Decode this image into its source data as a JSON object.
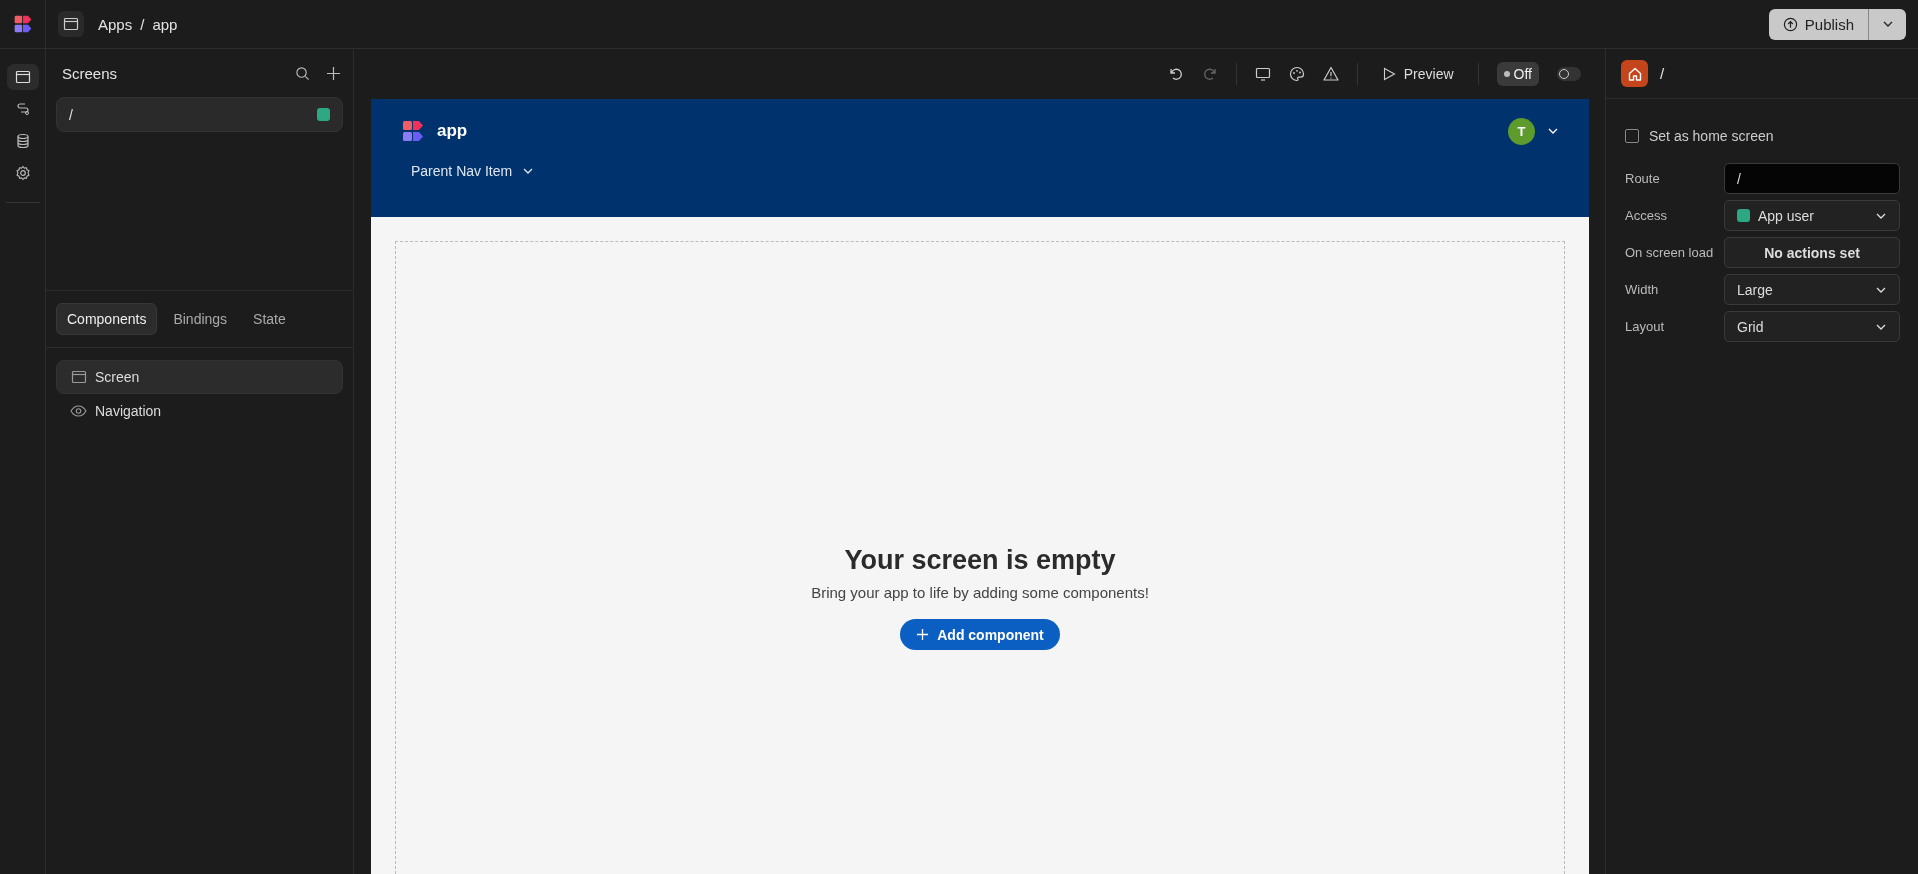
{
  "topbar": {
    "breadcrumb": [
      "Apps",
      "app"
    ],
    "separator": "/",
    "publish": "Publish"
  },
  "rail": [
    {
      "kind": "screens",
      "selected": true
    },
    {
      "kind": "automations",
      "selected": false
    },
    {
      "kind": "data",
      "selected": false
    },
    {
      "kind": "settings",
      "selected": false
    }
  ],
  "screens_panel": {
    "title": "Screens",
    "screens": [
      {
        "route": "/",
        "selected": true,
        "color": "#2ea883"
      }
    ]
  },
  "tabs": [
    {
      "label": "Components",
      "selected": true
    },
    {
      "label": "Bindings",
      "selected": false
    },
    {
      "label": "State",
      "selected": false
    }
  ],
  "component_tree": [
    {
      "label": "Screen",
      "kind": "screen",
      "selected": true
    },
    {
      "label": "Navigation",
      "kind": "navigation",
      "selected": false
    }
  ],
  "toolbar": {
    "preview": "Preview",
    "status": "Off",
    "switch_on": false
  },
  "app_preview": {
    "app_name": "app",
    "avatar": "T",
    "nav_items": [
      "Parent Nav Item"
    ],
    "empty_title": "Your screen is empty",
    "empty_text": "Bring your app to life by adding some components!",
    "add_button": "Add component"
  },
  "settings": {
    "title": "/",
    "home_checkbox": {
      "label": "Set as home screen",
      "checked": false
    },
    "fields": [
      {
        "label": "Route",
        "kind": "input",
        "value": "/"
      },
      {
        "label": "Access",
        "kind": "select",
        "value": "App user",
        "color": "#2ea883"
      },
      {
        "label": "On screen load",
        "kind": "button",
        "value": "No actions set"
      },
      {
        "label": "Width",
        "kind": "select",
        "value": "Large"
      },
      {
        "label": "Layout",
        "kind": "select",
        "value": "Grid"
      }
    ]
  }
}
